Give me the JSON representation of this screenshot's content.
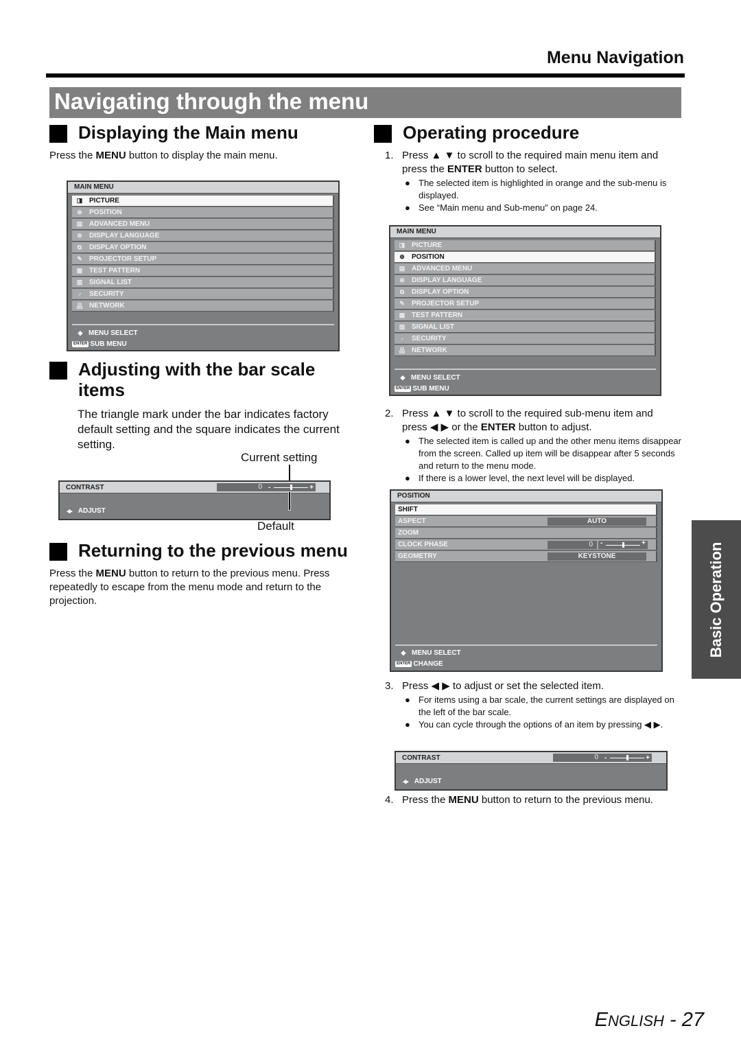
{
  "header": {
    "title": "Menu Navigation"
  },
  "banner": {
    "title": "Navigating through the menu"
  },
  "left": {
    "display_main": {
      "heading": "Displaying the Main menu",
      "text_pre": "Press the ",
      "text_bold": "MENU",
      "text_post": " button to display the main menu."
    },
    "main_menu_osd": {
      "title": "MAIN MENU",
      "selected_index": 0,
      "items": [
        {
          "icon": "picture-icon",
          "glyph": "◨",
          "label": "PICTURE"
        },
        {
          "icon": "position-icon",
          "glyph": "⊕",
          "label": "POSITION"
        },
        {
          "icon": "advanced-menu-icon",
          "glyph": "▤",
          "label": "ADVANCED MENU"
        },
        {
          "icon": "globe-icon",
          "glyph": "⊕",
          "label": "DISPLAY LANGUAGE"
        },
        {
          "icon": "display-option-icon",
          "glyph": "⧉",
          "label": "DISPLAY OPTION"
        },
        {
          "icon": "wrench-icon",
          "glyph": "✎",
          "label": "PROJECTOR SETUP"
        },
        {
          "icon": "test-pattern-icon",
          "glyph": "▦",
          "label": "TEST PATTERN"
        },
        {
          "icon": "signal-list-icon",
          "glyph": "▥",
          "label": "SIGNAL LIST"
        },
        {
          "icon": "key-icon",
          "glyph": "♂",
          "label": "SECURITY"
        },
        {
          "icon": "network-icon",
          "glyph": "品",
          "label": "NETWORK"
        }
      ],
      "footer": [
        {
          "key": "◆",
          "label": "MENU SELECT"
        },
        {
          "key": "ENTER",
          "label": "SUB MENU"
        }
      ]
    },
    "bar_scale": {
      "heading_line1": "Adjusting with the bar scale",
      "heading_line2": "items",
      "text": "The triangle mark under the bar indicates factory default setting and the square indicates the current setting.",
      "current_label": "Current setting",
      "default_label": "Default",
      "osd": {
        "item": "CONTRAST",
        "value": "0",
        "bar_fraction": 0.5,
        "footer_key": "◆",
        "footer_label": "ADJUST",
        "minus": "-",
        "plus": "+"
      }
    },
    "returning": {
      "heading": "Returning to the previous menu",
      "text_pre": "Press the ",
      "text_bold": "MENU",
      "text_post": " button to return to the previous menu. Press repeatedly to escape from the menu mode and return to the projection."
    }
  },
  "right": {
    "heading": "Operating procedure",
    "step1": {
      "num": "1.",
      "line1": "Press ▲ ▼ to scroll to the required main menu item and",
      "line2_pre": "press the ",
      "line2_bold": "ENTER",
      "line2_post": " button to select.",
      "bullets": [
        "The selected item is highlighted in orange and the sub-menu is displayed.",
        "See “Main menu and Sub-menu” on page 24."
      ]
    },
    "main_menu_osd": {
      "title": "MAIN MENU",
      "selected_index": 1,
      "items": [
        {
          "icon": "picture-icon",
          "glyph": "◨",
          "label": "PICTURE"
        },
        {
          "icon": "position-icon",
          "glyph": "⊕",
          "label": "POSITION"
        },
        {
          "icon": "advanced-menu-icon",
          "glyph": "▤",
          "label": "ADVANCED MENU"
        },
        {
          "icon": "globe-icon",
          "glyph": "⊕",
          "label": "DISPLAY LANGUAGE"
        },
        {
          "icon": "display-option-icon",
          "glyph": "⧉",
          "label": "DISPLAY OPTION"
        },
        {
          "icon": "wrench-icon",
          "glyph": "✎",
          "label": "PROJECTOR SETUP"
        },
        {
          "icon": "test-pattern-icon",
          "glyph": "▦",
          "label": "TEST PATTERN"
        },
        {
          "icon": "signal-list-icon",
          "glyph": "▥",
          "label": "SIGNAL LIST"
        },
        {
          "icon": "key-icon",
          "glyph": "♂",
          "label": "SECURITY"
        },
        {
          "icon": "network-icon",
          "glyph": "品",
          "label": "NETWORK"
        }
      ],
      "footer": [
        {
          "key": "◆",
          "label": "MENU SELECT"
        },
        {
          "key": "ENTER",
          "label": "SUB MENU"
        }
      ]
    },
    "step2": {
      "num": "2.",
      "line1": "Press ▲ ▼ to scroll to the required sub-menu item and",
      "line2_pre": "press ◀ ▶ or the ",
      "line2_bold": "ENTER",
      "line2_post": " button to adjust.",
      "bullets": [
        "The selected item is called up and the other menu items disappear from the screen. Called up item will be disappear after 5 seconds and return to the menu mode.",
        "If there is a lower level, the next level will be displayed."
      ]
    },
    "position_osd": {
      "title": "POSITION",
      "selected_index": 0,
      "items": [
        {
          "label": "SHIFT",
          "value": null
        },
        {
          "label": "ASPECT",
          "value": "AUTO"
        },
        {
          "label": "ZOOM",
          "value": null
        },
        {
          "label": "CLOCK PHASE",
          "number": "0",
          "bar_fraction": 0.5
        },
        {
          "label": "GEOMETRY",
          "value": "KEYSTONE"
        }
      ],
      "footer": [
        {
          "key": "◆",
          "label": "MENU SELECT"
        },
        {
          "key": "ENTER",
          "label": "CHANGE"
        }
      ]
    },
    "step3": {
      "num": "3.",
      "line1": "Press ◀ ▶ to adjust or set the selected item.",
      "bullets": [
        "For items using a bar scale, the current settings are displayed on the left of the bar scale.",
        "You can cycle through the options of an item by pressing ◀ ▶."
      ]
    },
    "contrast_osd": {
      "item": "CONTRAST",
      "value": "0",
      "bar_fraction": 0.5,
      "footer_key": "◆",
      "footer_label": "ADJUST",
      "minus": "-",
      "plus": "+"
    },
    "step4": {
      "num": "4.",
      "line_pre": "Press the ",
      "line_bold": "MENU",
      "line_post": " button to return to the previous menu."
    }
  },
  "side_tab": {
    "label": "Basic Operation"
  },
  "footer": {
    "language_cap": "E",
    "language_rest": "NGLISH",
    "separator": " - ",
    "page": "27"
  }
}
